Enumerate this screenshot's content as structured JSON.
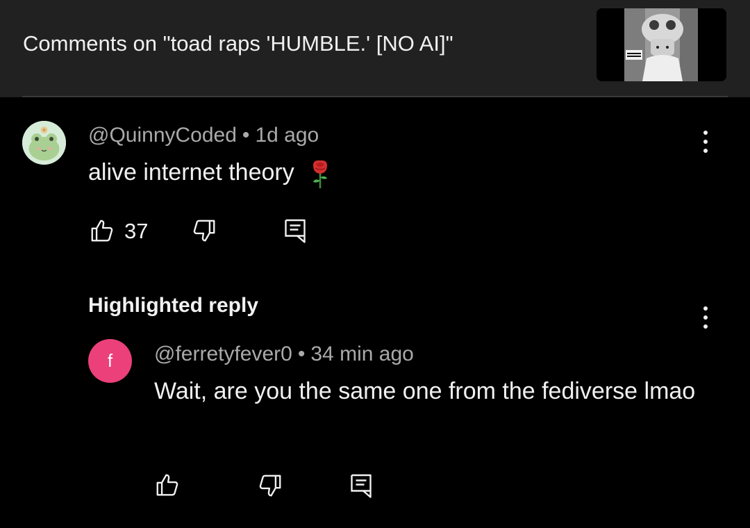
{
  "header": {
    "title": "Comments on \"toad raps 'HUMBLE.' [NO AI]\""
  },
  "comment": {
    "author": "@QuinnyCoded",
    "separator": "•",
    "time": "1d ago",
    "text": "alive internet theory",
    "emoji_icon": "rose-icon",
    "like_count": "37"
  },
  "highlight": {
    "label": "Highlighted reply"
  },
  "reply": {
    "avatar_letter": "f",
    "avatar_color": "#ec407a",
    "author": "@ferretyfever0",
    "separator": "•",
    "time": "34 min ago",
    "text": "Wait, are you the same one from the fediverse lmao"
  },
  "colors": {
    "background": "#000000",
    "header_bg": "#212121",
    "primary_text": "#f1f1f1",
    "secondary_text": "#aaaaaa"
  }
}
